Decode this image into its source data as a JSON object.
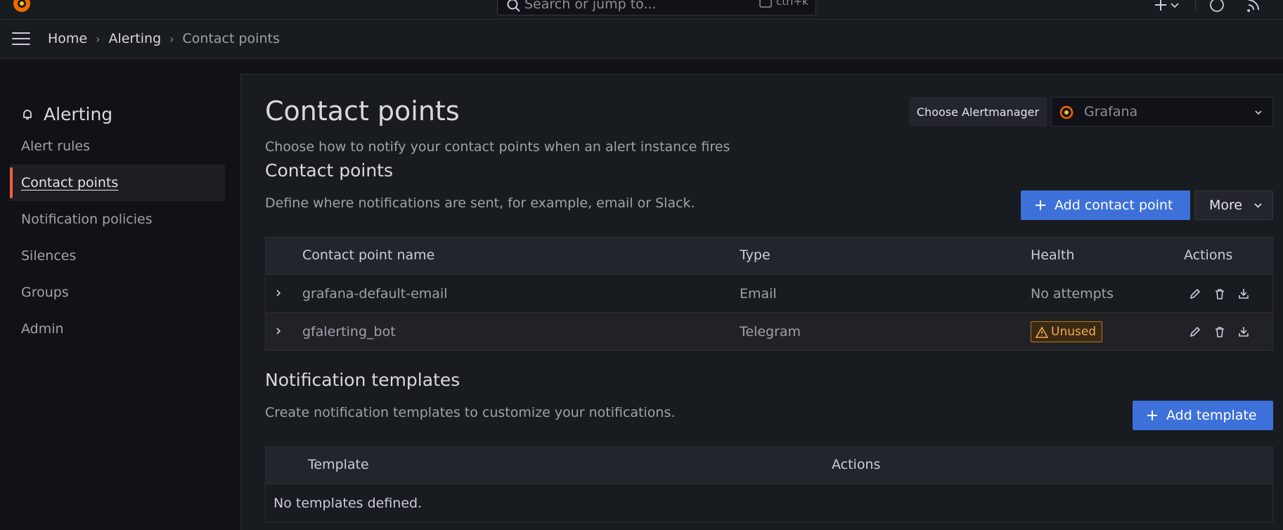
{
  "topbar": {
    "search_placeholder": "Search or jump to...",
    "search_shortcut": "ctrl+k"
  },
  "breadcrumb": [
    "Home",
    "Alerting",
    "Contact points"
  ],
  "sidebar": {
    "title": "Alerting",
    "items": [
      {
        "label": "Alert rules"
      },
      {
        "label": "Contact points",
        "active": true
      },
      {
        "label": "Notification policies"
      },
      {
        "label": "Silences"
      },
      {
        "label": "Groups"
      },
      {
        "label": "Admin"
      }
    ]
  },
  "header": {
    "title": "Contact points",
    "subtitle": "Choose how to notify your contact points when an alert instance fires",
    "alertmanager_label": "Choose Alertmanager",
    "alertmanager_value": "Grafana"
  },
  "contact_points": {
    "title": "Contact points",
    "subtitle": "Define where notifications are sent, for example, email or Slack.",
    "add_label": "Add contact point",
    "more_label": "More",
    "columns": [
      "Contact point name",
      "Type",
      "Health",
      "Actions"
    ],
    "rows": [
      {
        "name": "grafana-default-email",
        "type": "Email",
        "health": "No attempts"
      },
      {
        "name": "gfalerting_bot",
        "type": "Telegram",
        "health": "Unused"
      }
    ]
  },
  "templates": {
    "title": "Notification templates",
    "subtitle": "Create notification templates to customize your notifications.",
    "add_label": "Add template",
    "columns": [
      "Template",
      "Actions"
    ],
    "empty_text": "No templates defined."
  },
  "colors": {
    "primary": "#3d71d9",
    "accent": "#f55f3e",
    "warning": "#f8a94b"
  }
}
